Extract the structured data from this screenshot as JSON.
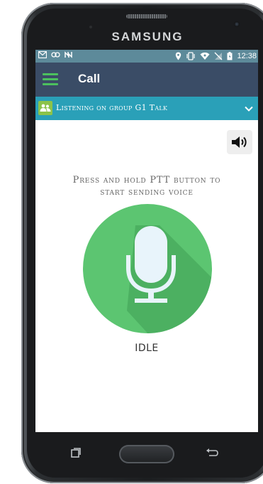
{
  "device": {
    "brand": "SAMSUNG"
  },
  "status_bar": {
    "left_icons": [
      "mail-icon",
      "link-icon",
      "nfc-icon"
    ],
    "right_icons": [
      "location-icon",
      "vibrate-icon",
      "wifi-icon",
      "no-signal-icon",
      "battery-icon"
    ],
    "time": "12:38"
  },
  "app_bar": {
    "title": "Call"
  },
  "group_bar": {
    "text": "Listening on group G1 Talk"
  },
  "main": {
    "instruction_line1": "Press and hold PTT button to",
    "instruction_line2": "start sending voice",
    "ptt_icon": "microphone-icon",
    "state": "IDLE",
    "speaker_icon": "speaker-icon"
  },
  "colors": {
    "status_bar": "#5d8a9a",
    "app_bar": "#3a4c66",
    "accent_green": "#4cc05e",
    "group_bar": "#2aa0b8",
    "ptt_button": "#5cc571"
  }
}
